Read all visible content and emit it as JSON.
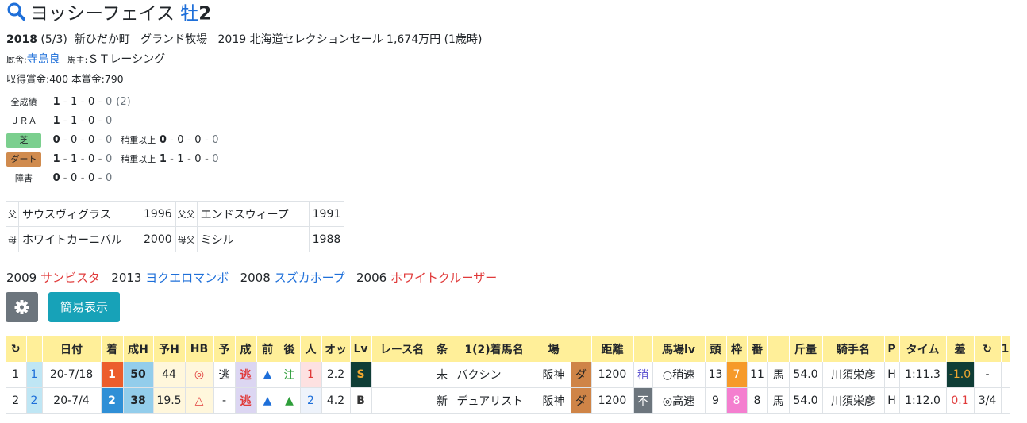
{
  "horse": {
    "name": "ヨッシーフェイス",
    "sex": "牡",
    "age": "2"
  },
  "profile": {
    "birth_year": "2018",
    "birth_date": "(5/3)",
    "region": "新ひだか町",
    "breeder": "グランド牧場",
    "sale": "2019 北海道セレクションセール 1,674万円 (1歳時)",
    "stable_label": "厩舎:",
    "trainer": "寺島良",
    "owner_label": "馬主:",
    "owner": "ＳＴレーシング",
    "earnings": "収得賞金:400",
    "prize": "本賞金:790"
  },
  "records": [
    {
      "label": "全成績",
      "v": [
        "1",
        "1",
        "0",
        "0"
      ],
      "extra": "(2)"
    },
    {
      "label": "ＪＲＡ",
      "v": [
        "1",
        "1",
        "0",
        "0"
      ]
    },
    {
      "label": "芝",
      "v": [
        "0",
        "0",
        "0",
        "0"
      ],
      "sub_label": "稍重以上",
      "sub": [
        "0",
        "0",
        "0",
        "0"
      ]
    },
    {
      "label": "ダート",
      "v": [
        "1",
        "1",
        "0",
        "0"
      ],
      "sub_label": "稍重以上",
      "sub": [
        "1",
        "1",
        "0",
        "0"
      ]
    },
    {
      "label": "障害",
      "v": [
        "0",
        "0",
        "0",
        "0"
      ]
    }
  ],
  "pedigree": [
    {
      "k1": "父",
      "n1": "サウスヴィグラス",
      "y1": "1996",
      "k2": "父父",
      "n2": "エンドスウィープ",
      "y2": "1991"
    },
    {
      "k1": "母",
      "n1": "ホワイトカーニバル",
      "y1": "2000",
      "k2": "母父",
      "n2": "ミシル",
      "y2": "1988"
    }
  ],
  "siblings": [
    {
      "year": "2009",
      "name": "サンビスタ",
      "color": "#e03a3a"
    },
    {
      "year": "2013",
      "name": "ヨクエロマンボ",
      "color": "#1e6fd9"
    },
    {
      "year": "2008",
      "name": "スズカホープ",
      "color": "#1e6fd9"
    },
    {
      "year": "2006",
      "name": "ホワイトクルーザー",
      "color": "#e03a3a"
    }
  ],
  "buttons": {
    "simple": "簡易表示"
  },
  "results": {
    "headers": [
      "↻",
      "",
      "日付",
      "着",
      "成H",
      "予H",
      "HB",
      "予",
      "成",
      "前",
      "後",
      "人",
      "オッ",
      "Lv",
      "レース名",
      "条",
      "1(2)着馬名",
      "場",
      "",
      "距離",
      "",
      "馬場lv",
      "頭",
      "枠",
      "番",
      "",
      "斤量",
      "騎手名",
      "P",
      "タイム",
      "差",
      "↻",
      "1"
    ],
    "rows": [
      [
        "1",
        "1",
        "20-7/18",
        "1",
        "50",
        "44",
        "◎",
        "逃",
        "逃",
        "▲",
        "注",
        "1",
        "2.2",
        "S",
        "",
        "未",
        "バクシン",
        "阪神",
        "ダ",
        "1200",
        "稍",
        "○稍速",
        "13",
        "7",
        "11",
        "馬",
        "54.0",
        "川須栄彦",
        "H",
        "1:11.3",
        "-1.0",
        "",
        ""
      ],
      [
        "2",
        "2",
        "20-7/4",
        "2",
        "38",
        "19.5",
        "△",
        "-",
        "逃",
        "▲",
        "▲",
        "2",
        "4.2",
        "B",
        "",
        "新",
        "デュアリスト",
        "阪神",
        "ダ",
        "1200",
        "不",
        "◎高速",
        "9",
        "8",
        "8",
        "馬",
        "54.0",
        "川須栄彦",
        "H",
        "1:12.0",
        "0.1",
        "3/4",
        ""
      ]
    ]
  }
}
